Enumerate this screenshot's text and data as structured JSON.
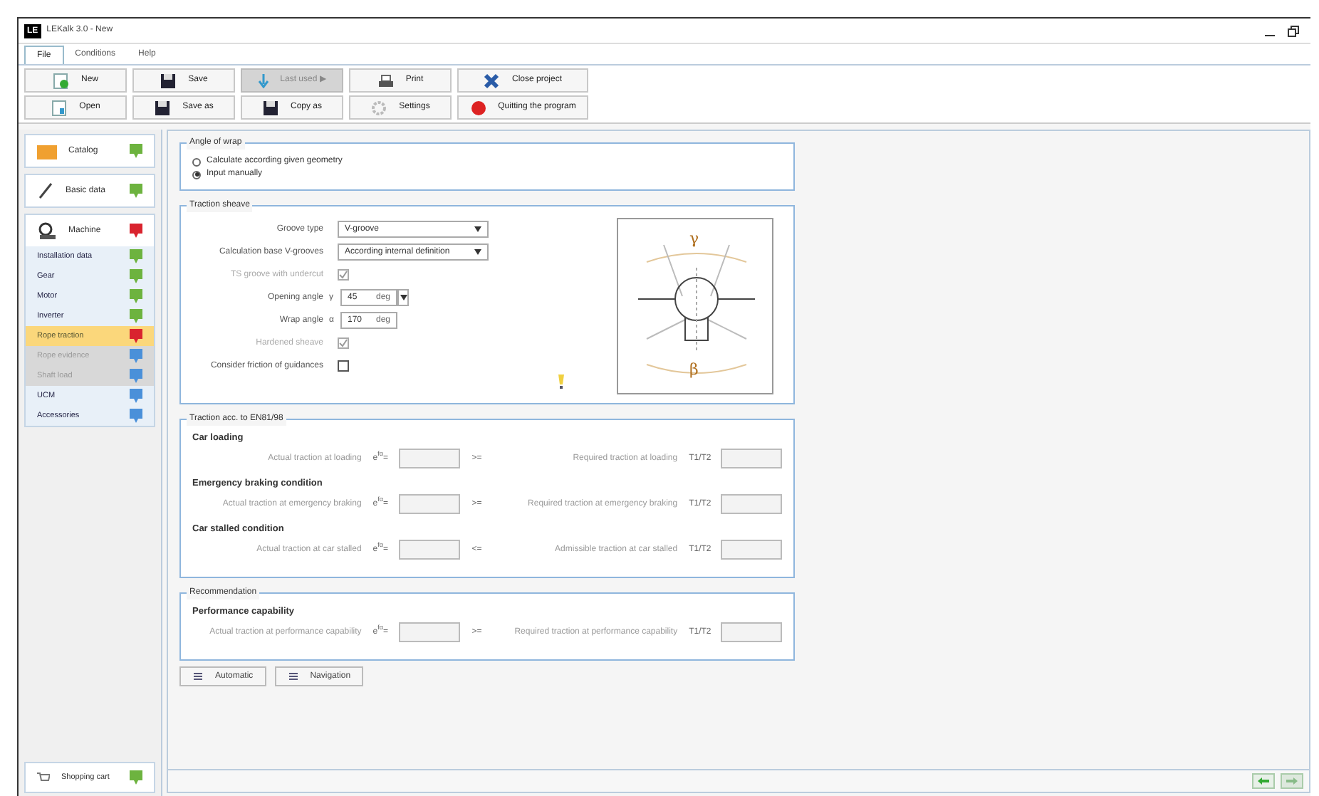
{
  "window": {
    "title": "LEKalk 3.0 - New",
    "logo": "LE"
  },
  "menu_tabs": [
    {
      "label": "File",
      "selected": true
    },
    {
      "label": "Conditions",
      "selected": false
    },
    {
      "label": "Help",
      "selected": false
    }
  ],
  "toolbar": [
    [
      {
        "label": "New",
        "disabled": false
      },
      {
        "label": "Save",
        "disabled": false
      },
      {
        "label": "Last used ▶",
        "disabled": true
      },
      {
        "label": "Print",
        "disabled": false
      },
      {
        "label": "Close project",
        "disabled": false
      }
    ],
    [
      {
        "label": "Open",
        "disabled": false
      },
      {
        "label": "Save as",
        "disabled": false
      },
      {
        "label": "Copy as",
        "disabled": false
      },
      {
        "label": "Settings",
        "disabled": false
      },
      {
        "label": "Quitting the program",
        "disabled": false
      }
    ]
  ],
  "sidebar": {
    "sections": [
      {
        "label": "Catalog",
        "color": "#6db33f"
      },
      {
        "label": "Basic data",
        "color": "#6db33f"
      },
      {
        "label": "Machine",
        "color": "#d9232e",
        "children": [
          {
            "label": "Installation data",
            "color": "#6db33f",
            "selected": false,
            "disabled": false
          },
          {
            "label": "Gear",
            "color": "#6db33f",
            "selected": false,
            "disabled": false
          },
          {
            "label": "Motor",
            "color": "#6db33f",
            "selected": false,
            "disabled": false
          },
          {
            "label": "Inverter",
            "color": "#6db33f",
            "selected": false,
            "disabled": false
          },
          {
            "label": "Rope traction",
            "color": "#d9232e",
            "selected": true,
            "disabled": false
          },
          {
            "label": "Rope evidence",
            "color": "#4a90d9",
            "selected": false,
            "disabled": true
          },
          {
            "label": "Shaft load",
            "color": "#4a90d9",
            "selected": false,
            "disabled": true
          },
          {
            "label": "UCM",
            "color": "#4a90d9",
            "selected": false,
            "disabled": false
          },
          {
            "label": "Accessories",
            "color": "#4a90d9",
            "selected": false,
            "disabled": false
          }
        ]
      }
    ],
    "cart": {
      "label": "Shopping cart",
      "color": "#6db33f"
    }
  },
  "angle_of_wrap": {
    "title": "Angle of wrap",
    "options": [
      {
        "label": "Calculate according given geometry",
        "selected": false
      },
      {
        "label": "Input manually",
        "selected": true
      }
    ]
  },
  "traction_sheave": {
    "title": "Traction sheave",
    "rows": [
      {
        "kind": "select",
        "label": "Groove type",
        "value": "V-groove"
      },
      {
        "kind": "select",
        "label": "Calculation base V-grooves",
        "value": "According internal definition"
      },
      {
        "kind": "checkbox",
        "label": "TS groove with undercut",
        "checked": true,
        "disabled": true
      },
      {
        "kind": "unit",
        "label": "Opening angle",
        "symbol": "γ",
        "value": "45",
        "unit": "deg",
        "dropdown": true
      },
      {
        "kind": "unit",
        "label": "Wrap angle",
        "symbol": "α",
        "value": "170",
        "unit": "deg"
      },
      {
        "kind": "checkbox",
        "label": "Hardened sheave",
        "checked": true,
        "disabled": true
      },
      {
        "kind": "checkbox",
        "label": "Consider friction of guidances",
        "checked": false,
        "disabled": false
      }
    ],
    "diagram": {
      "top_label": "γ",
      "bottom_label": "β"
    }
  },
  "traction": {
    "title": "Traction acc. to EN81/98",
    "groups": [
      {
        "heading": "Car loading",
        "left": "Actual traction at loading",
        "symbol": "e$^{fα}$=",
        "relation": ">=",
        "right": "Required traction at loading",
        "ratio": "T1/T2"
      },
      {
        "heading": "Emergency braking condition",
        "left": "Actual traction at emergency braking",
        "symbol": "e$^{fα}$=",
        "relation": ">=",
        "right": "Required traction at emergency braking",
        "ratio": "T1/T2"
      },
      {
        "heading": "Car stalled condition",
        "left": "Actual traction at car stalled",
        "symbol": "e$^{fα}$=",
        "relation": "<=",
        "right": "Admissible traction at car stalled",
        "ratio": "T1/T2"
      }
    ]
  },
  "recommendation": {
    "title": "Recommendation",
    "groups": [
      {
        "heading": "Performance capability",
        "left": "Actual traction at performance capability",
        "symbol": "e$^{fα}$=",
        "relation": ">=",
        "right": "Required traction at performance capability",
        "ratio": "T1/T2"
      }
    ]
  },
  "actions": [
    "Automatic",
    "Navigation"
  ]
}
